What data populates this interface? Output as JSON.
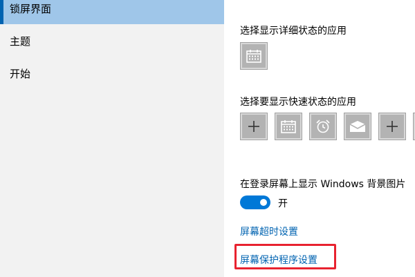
{
  "sidebar": {
    "items": [
      {
        "label": "锁屏界面",
        "selected": true
      },
      {
        "label": "主题",
        "selected": false
      },
      {
        "label": "开始",
        "selected": false
      }
    ]
  },
  "main": {
    "detailed_status_title": "选择显示详细状态的应用",
    "detailed_status_apps": [
      "calendar-icon"
    ],
    "quick_status_title": "选择要显示快速状态的应用",
    "quick_status_apps": [
      "plus-icon",
      "calendar-icon",
      "alarm-clock-icon",
      "mail-icon",
      "plus-icon"
    ],
    "background_title": "在登录屏幕上显示 Windows 背景图片",
    "background_toggle": {
      "state_label": "开",
      "on": true
    },
    "screen_timeout_link": "屏幕超时设置",
    "screensaver_link": "屏幕保护程序设置"
  },
  "colors": {
    "accent": "#0078d7",
    "link": "#0063b1",
    "sidebar_selected": "#9fc6e9",
    "highlight": "#e8222f"
  }
}
